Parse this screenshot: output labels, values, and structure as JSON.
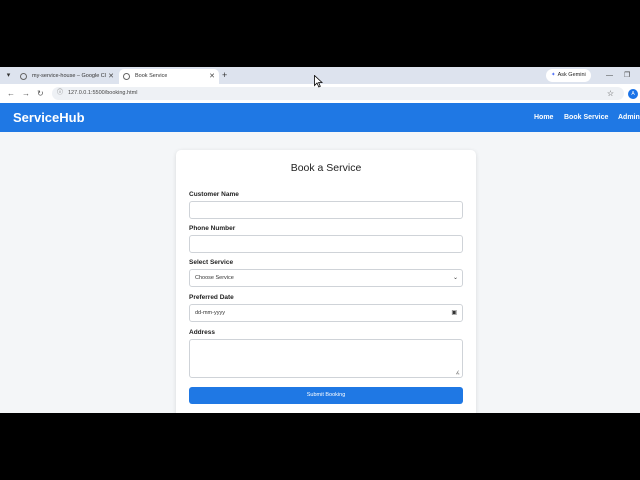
{
  "browser": {
    "tabs": [
      {
        "title": "my-service-house – Google Cl",
        "active": false
      },
      {
        "title": "Book Service",
        "active": true
      }
    ],
    "new_tab": "+",
    "ask_gemini": "Ask Gemini",
    "url": "127.0.0.1:5500/booking.html",
    "profile_initial": "A"
  },
  "app": {
    "brand": "ServiceHub",
    "nav": {
      "home": "Home",
      "book": "Book Service",
      "admin": "Admin"
    },
    "accent": "#1f78e4"
  },
  "form": {
    "title": "Book a Service",
    "customer_name_label": "Customer Name",
    "phone_label": "Phone Number",
    "service_label": "Select Service",
    "service_value": "Choose Service",
    "date_label": "Preferred Date",
    "date_placeholder": "dd-mm-yyyy",
    "address_label": "Address",
    "submit_label": "Submit Booking"
  }
}
